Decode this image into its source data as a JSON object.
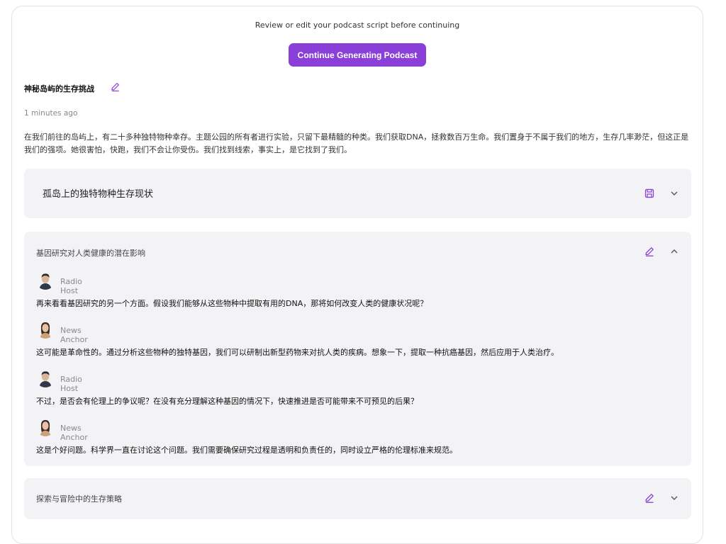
{
  "header": {
    "note": "Review or edit your podcast script before continuing",
    "continue_label": "Continue Generating Podcast"
  },
  "script": {
    "title": "神秘岛屿的生存挑战",
    "time": "1 minutes ago",
    "summary": "在我们前往的岛屿上，有二十多种独特物种幸存。主题公园的所有者进行实验，只留下最精髓的种类。我们获取DNA，拯救数百万生命。我们置身于不属于我们的地方，生存几率渺茫，但这正是我们的强项。她很害怕，快跑，我们不会让你受伤。我们找到线索，事实上，是它找到了我们。"
  },
  "sections": [
    {
      "title": "孤岛上的独特物种生存现状",
      "state": "collapsed"
    },
    {
      "title": "基因研究对人类健康的潜在影响",
      "state": "expanded",
      "lines": [
        {
          "speaker": "Radio Host",
          "text": "再来看看基因研究的另一个方面。假设我们能够从这些物种中提取有用的DNA，那将如何改变人类的健康状况呢？"
        },
        {
          "speaker": "News Anchor",
          "text": "这可能是革命性的。通过分析这些物种的独特基因，我们可以研制出新型药物来对抗人类的疾病。想象一下，提取一种抗癌基因，然后应用于人类治疗。"
        },
        {
          "speaker": "Radio Host",
          "text": "不过，是否会有伦理上的争议呢？在没有充分理解这种基因的情况下，快速推进是否可能带来不可预见的后果？"
        },
        {
          "speaker": "News Anchor",
          "text": "这是个好问题。科学界一直在讨论这个问题。我们需要确保研究过程是透明和负责任的，同时设立严格的伦理标准来规范。"
        }
      ]
    },
    {
      "title": "探索与冒险中的生存策略",
      "state": "collapsed"
    }
  ],
  "colors": {
    "accent": "#8b3fd9",
    "section_bg": "#f3f3f6"
  },
  "icons": [
    "pencil-icon",
    "save-icon",
    "chevron-down-icon",
    "chevron-up-icon"
  ]
}
